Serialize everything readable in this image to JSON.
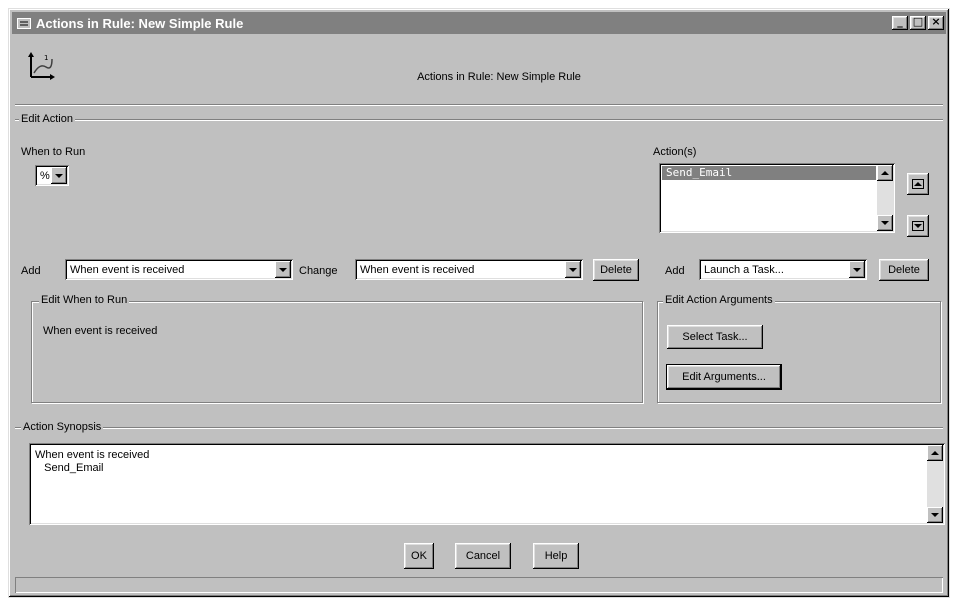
{
  "window": {
    "title": "Actions in Rule: New Simple Rule"
  },
  "titlebar_buttons": {
    "minimize": "_",
    "maximize": "□",
    "close": "×"
  },
  "header": {
    "title": "Actions in Rule: New Simple Rule",
    "logo_icon": "axis-chart-icon"
  },
  "edit_action": {
    "group_label": "Edit Action",
    "when_to_run_label": "When to Run",
    "when_to_run_value": "%",
    "actions_label": "Action(s)",
    "actions_list": [
      "Send_Email"
    ],
    "add_label": "Add",
    "add_value": "When event is received",
    "change_label": "Change",
    "change_value": "When event is received",
    "delete_label": "Delete",
    "action_add_label": "Add",
    "action_add_value": "Launch a Task...",
    "action_delete_label": "Delete"
  },
  "edit_when_to_run": {
    "group_label": "Edit When to Run",
    "text": "When event is received"
  },
  "edit_action_arguments": {
    "group_label": "Edit Action Arguments",
    "select_task_label": "Select Task...",
    "edit_arguments_label": "Edit Arguments..."
  },
  "action_synopsis": {
    "group_label": "Action Synopsis",
    "line1": "When event is received",
    "line2": "   Send_Email"
  },
  "footer": {
    "ok_label": "OK",
    "cancel_label": "Cancel",
    "help_label": "Help"
  },
  "colors": {
    "face": "#c0c0c0",
    "title_bar": "#808080",
    "selection": "#808080"
  }
}
